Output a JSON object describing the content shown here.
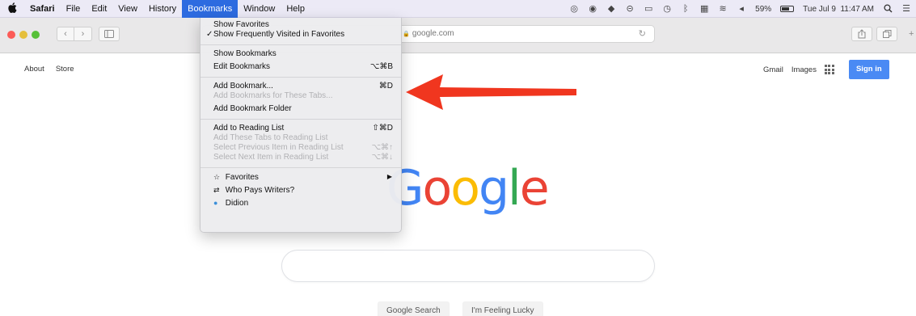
{
  "menubar": {
    "apple_icon": "apple-icon",
    "items": [
      "Safari",
      "File",
      "Edit",
      "View",
      "History",
      "Bookmarks",
      "Window",
      "Help"
    ],
    "active_item": "Bookmarks",
    "status": {
      "icons": [
        "compass-icon",
        "dashboard-icon",
        "dropbox-icon",
        "cloud-icon",
        "airplay-icon",
        "time-machine-icon",
        "bluetooth-icon",
        "keyboard-icon",
        "wifi-icon",
        "volume-icon"
      ],
      "battery_percent": "59%",
      "battery_level": 0.59,
      "datetime": "Tue Jul 9  11:47 AM",
      "search_icon": "spotlight-icon",
      "list_icon": "notification-center-icon"
    }
  },
  "toolbar": {
    "back_glyph": "‹",
    "forward_glyph": "›",
    "url": "google.com",
    "lock_glyph": "🔒",
    "reload_glyph": "↻"
  },
  "google": {
    "left_links": [
      "About",
      "Store"
    ],
    "right_links": [
      "Gmail",
      "Images"
    ],
    "signin_label": "Sign in",
    "logo_letters": [
      "G",
      "o",
      "o",
      "g",
      "l",
      "e"
    ],
    "logo_colors": [
      "#4285f4",
      "#ea4335",
      "#fbbc05",
      "#4285f4",
      "#34a853",
      "#ea4335"
    ],
    "search_button": "Google Search",
    "lucky_button": "I'm Feeling Lucky"
  },
  "bookmarks_menu": {
    "groups": [
      [
        {
          "label": "Show Favorites",
          "shortcut": "",
          "disabled": false,
          "checked": false
        },
        {
          "label": "Show Frequently Visited in Favorites",
          "shortcut": "",
          "disabled": false,
          "checked": true
        }
      ],
      [
        {
          "label": "Show Bookmarks",
          "shortcut": "",
          "disabled": false,
          "checked": false
        },
        {
          "label": "Edit Bookmarks",
          "shortcut": "⌥⌘B",
          "disabled": false,
          "checked": false
        }
      ],
      [
        {
          "label": "Add Bookmark...",
          "shortcut": "⌘D",
          "disabled": false,
          "checked": false
        },
        {
          "label": "Add Bookmarks for These Tabs...",
          "shortcut": "",
          "disabled": true,
          "checked": false
        },
        {
          "label": "Add Bookmark Folder",
          "shortcut": "",
          "disabled": false,
          "checked": false
        }
      ],
      [
        {
          "label": "Add to Reading List",
          "shortcut": "⇧⌘D",
          "disabled": false,
          "checked": false
        },
        {
          "label": "Add These Tabs to Reading List",
          "shortcut": "",
          "disabled": true,
          "checked": false
        },
        {
          "label": "Select Previous Item in Reading List",
          "shortcut": "⌥⌘↑",
          "disabled": true,
          "checked": false
        },
        {
          "label": "Select Next Item in Reading List",
          "shortcut": "⌥⌘↓",
          "disabled": true,
          "checked": false
        }
      ],
      [
        {
          "label": "Favorites",
          "icon": "star-icon",
          "glyph": "☆",
          "submenu": true
        },
        {
          "label": "Who Pays Writers?",
          "icon": "arrows-icon",
          "glyph": "⇄",
          "submenu": false
        },
        {
          "label": "Didion",
          "icon": "globe-icon",
          "glyph": "●",
          "submenu": false
        }
      ]
    ],
    "check_glyph": "✓",
    "submenu_glyph": "▶"
  },
  "annotation": {
    "arrow_color": "#f0361f"
  }
}
